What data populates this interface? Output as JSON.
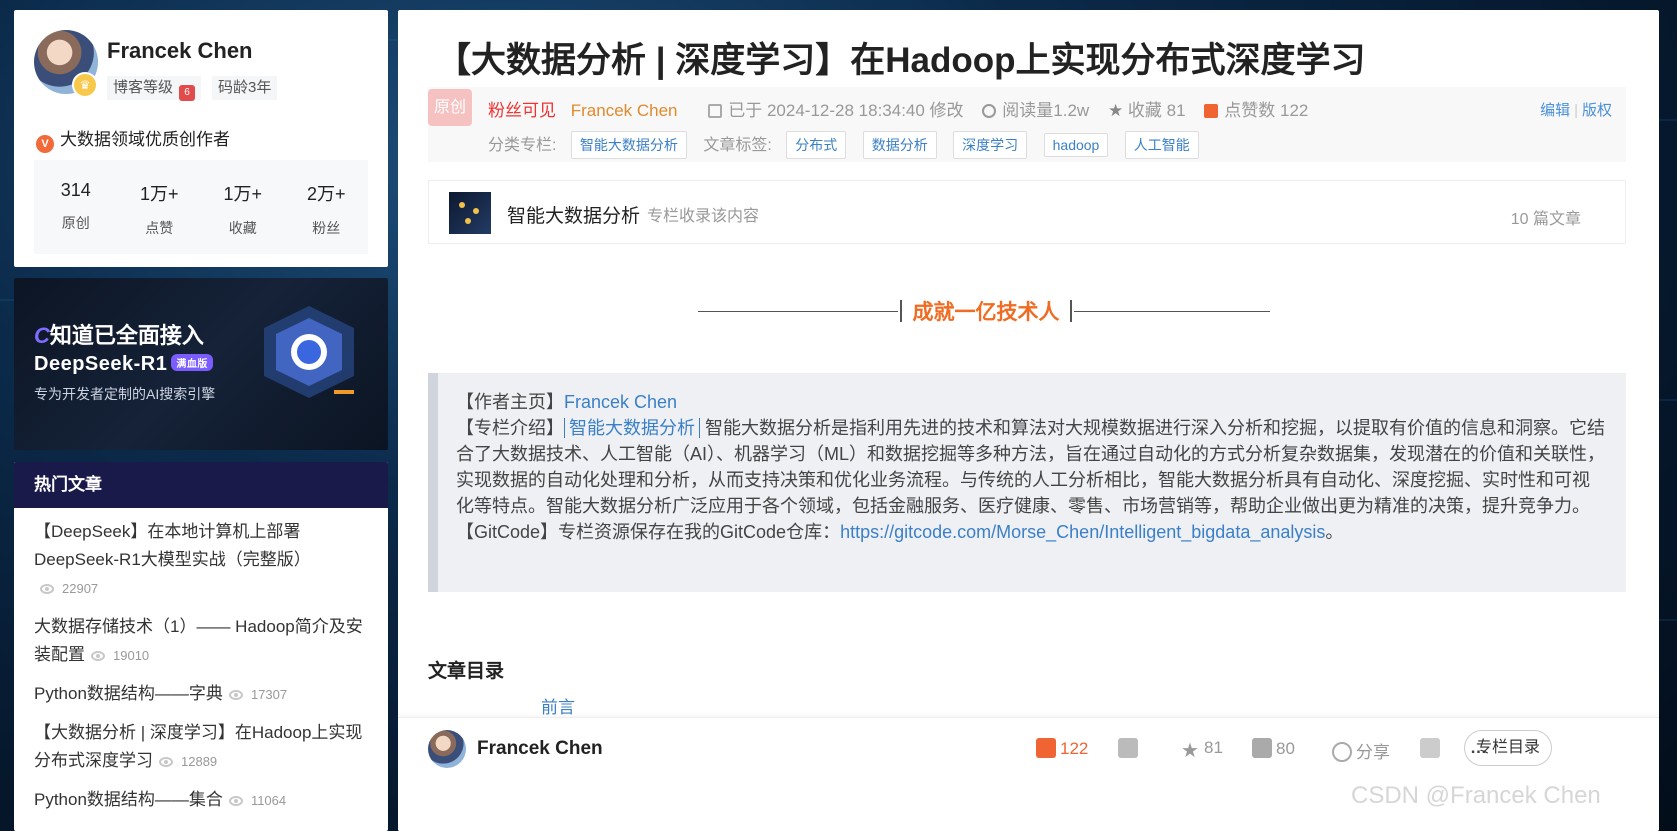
{
  "profile": {
    "name": "Francek Chen",
    "level": "博客等级",
    "code_age": "码龄3年",
    "creator_title": "大数据领域优质创作者",
    "creator_icon": "V",
    "stats": [
      {
        "num": "314",
        "label": "原创"
      },
      {
        "num": "1万+",
        "label": "点赞"
      },
      {
        "num": "1万+",
        "label": "收藏"
      },
      {
        "num": "2万+",
        "label": "粉丝"
      }
    ]
  },
  "ad": {
    "logo_c": "C",
    "logo_text": "知道已全面接入",
    "title": "DeepSeek-R1",
    "tag": "满血版",
    "subtitle": "专为开发者定制的AI搜索引擎"
  },
  "hot": {
    "header": "热门文章",
    "items": [
      {
        "title": "【DeepSeek】在本地计算机上部署DeepSeek-R1大模型实战（完整版）",
        "views": "22907"
      },
      {
        "title": "大数据存储技术（1）—— Hadoop简介及安装配置",
        "views": "19010"
      },
      {
        "title": "Python数据结构——字典",
        "views": "17307"
      },
      {
        "title": "【大数据分析 | 深度学习】在Hadoop上实现分布式深度学习",
        "views": "12889"
      },
      {
        "title": "Python数据结构——集合",
        "views": "11064"
      }
    ]
  },
  "article": {
    "title": "【大数据分析 | 深度学习】在Hadoop上实现分布式深度学习",
    "badge": "原创",
    "fans_only": "粉丝可见",
    "author": "Francek Chen",
    "date": "已于 2024-12-28 18:34:40 修改",
    "reads": "阅读量1.2w",
    "favorites": "收藏 81",
    "likes": "点赞数 122",
    "edit": "编辑",
    "copyright": "版权",
    "category_label": "分类专栏:",
    "category": "智能大数据分析",
    "tags_label": "文章标签:",
    "tags": [
      "分布式",
      "数据分析",
      "深度学习",
      "hadoop",
      "人工智能"
    ]
  },
  "column": {
    "name": "智能大数据分析",
    "desc": "专栏收录该内容",
    "count": "10 篇文章"
  },
  "slogan": "成就一亿技术人",
  "intro": {
    "author_prefix": "【作者主页】",
    "author_link": "Francek Chen",
    "column_prefix": "【专栏介绍】",
    "column_link": "智能大数据分析",
    "column_text": "智能大数据分析是指利用先进的技术和算法对大规模数据进行深入分析和挖掘，以提取有价值的信息和洞察。它结合了大数据技术、人工智能（AI）、机器学习（ML）和数据挖掘等多种方法，旨在通过自动化的方式分析复杂数据集，发现潜在的价值和关联性，实现数据的自动化处理和分析，从而支持决策和优化业务流程。与传统的人工分析相比，智能大数据分析具有自动化、深度挖掘、实时性和可视化等特点。智能大数据分析广泛应用于各个领域，包括金融服务、医疗健康、零售、市场营销等，帮助企业做出更为精准的决策，提升竞争力。",
    "gitcode_prefix": "【GitCode】专栏资源保存在我的GitCode仓库：",
    "gitcode_link": "https://gitcode.com/Morse_Chen/Intelligent_bigdata_analysis",
    "gitcode_suffix": "。"
  },
  "toc": {
    "title": "文章目录",
    "first_item": "前言"
  },
  "bottom_bar": {
    "author": "Francek Chen",
    "likes": "122",
    "favorites": "81",
    "comments": "80",
    "share": "分享",
    "more": "…",
    "toc_button": "专栏目录"
  },
  "watermark": "CSDN @Francek Chen",
  "colors": {
    "accent_orange": "#f06434",
    "link_blue": "#3b80c6",
    "fans_red": "#e33333",
    "hot_header_bg": "#1a1a4a"
  }
}
